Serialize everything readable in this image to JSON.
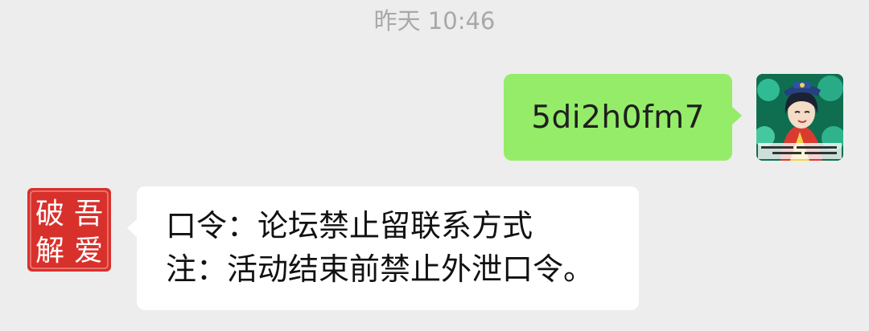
{
  "chat": {
    "timestamp": "昨天 10:46",
    "messages": [
      {
        "direction": "outgoing",
        "text": "5di2h0fm7",
        "avatar": "anime-character-avatar"
      },
      {
        "direction": "incoming",
        "avatar": "seal-logo-avatar",
        "avatar_seal_text": "吾爱破解",
        "lines": [
          "口令：论坛禁止留联系方式",
          "注：活动结束前禁止外泄口令。"
        ]
      }
    ]
  },
  "colors": {
    "background": "#ededed",
    "outgoing_bubble": "#95ec69",
    "incoming_bubble": "#ffffff",
    "timestamp": "#a8a8a8",
    "seal_red": "#d8312c"
  }
}
